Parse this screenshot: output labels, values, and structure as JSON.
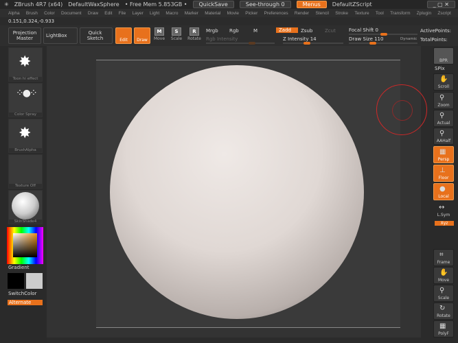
{
  "titlebar": {
    "app": "ZBrush 4R7 (x64)",
    "document": "DefaultWaxSphere",
    "mem": "• Free Mem 5.853GB •",
    "quicksave": "QuickSave",
    "seethrough": "See-through  0",
    "menus": "Menus",
    "script": "DefaultZScript"
  },
  "menu": [
    "Alpha",
    "Brush",
    "Color",
    "Document",
    "Draw",
    "Edit",
    "File",
    "Layer",
    "Light",
    "Macro",
    "Marker",
    "Material",
    "Movie",
    "Picker",
    "Preferences",
    "Render",
    "Stencil",
    "Stroke",
    "Texture",
    "Tool",
    "Transform",
    "Zplugin",
    "Zscript"
  ],
  "coords": "0.151,0.324,-0.933",
  "toolbar": {
    "projection_master": "Projection Master",
    "lightbox": "LightBox",
    "quick_sketch": "Quick Sketch",
    "edit": "Edit",
    "draw": "Draw",
    "move": "Move",
    "scale": "Scale",
    "rotate": "Rotate",
    "mrgb": "Mrgb",
    "rgb": "Rgb",
    "m": "M",
    "zadd": "Zadd",
    "zsub": "Zsub",
    "zcut": "Zcut",
    "rgb_intensity": "Rgb Intensity",
    "z_intensity": "Z Intensity 14",
    "focal_shift": "Focal Shift 0",
    "draw_size": "Draw Size 110",
    "dynamic": "Dynamic",
    "active_points": "ActivePoints:",
    "total_points": "TotalPoints:"
  },
  "values": {
    "z_intensity": 14,
    "focal_shift": 0,
    "draw_size": 110,
    "see_through": 0
  },
  "leftshelf": {
    "thumbs": [
      "Toon hi effect",
      "Color Spray",
      "BrushAlpha",
      "Texture Off",
      "SkinShade4"
    ],
    "gradient": "Gradient",
    "switchcolor": "SwitchColor",
    "alternate": "Alternate"
  },
  "rightshelf": {
    "bpr": "BPR",
    "spix": "SPix",
    "buttons": [
      "Scroll",
      "Zoom",
      "Actual",
      "AAHalf",
      "Persp",
      "Floor",
      "Local",
      "L.Sym",
      "Xyz",
      "Frame",
      "Move",
      "Scale",
      "Rotate",
      "PolyF"
    ]
  },
  "colors": {
    "accent": "#e8711c",
    "brush_circle": "#d02828"
  }
}
